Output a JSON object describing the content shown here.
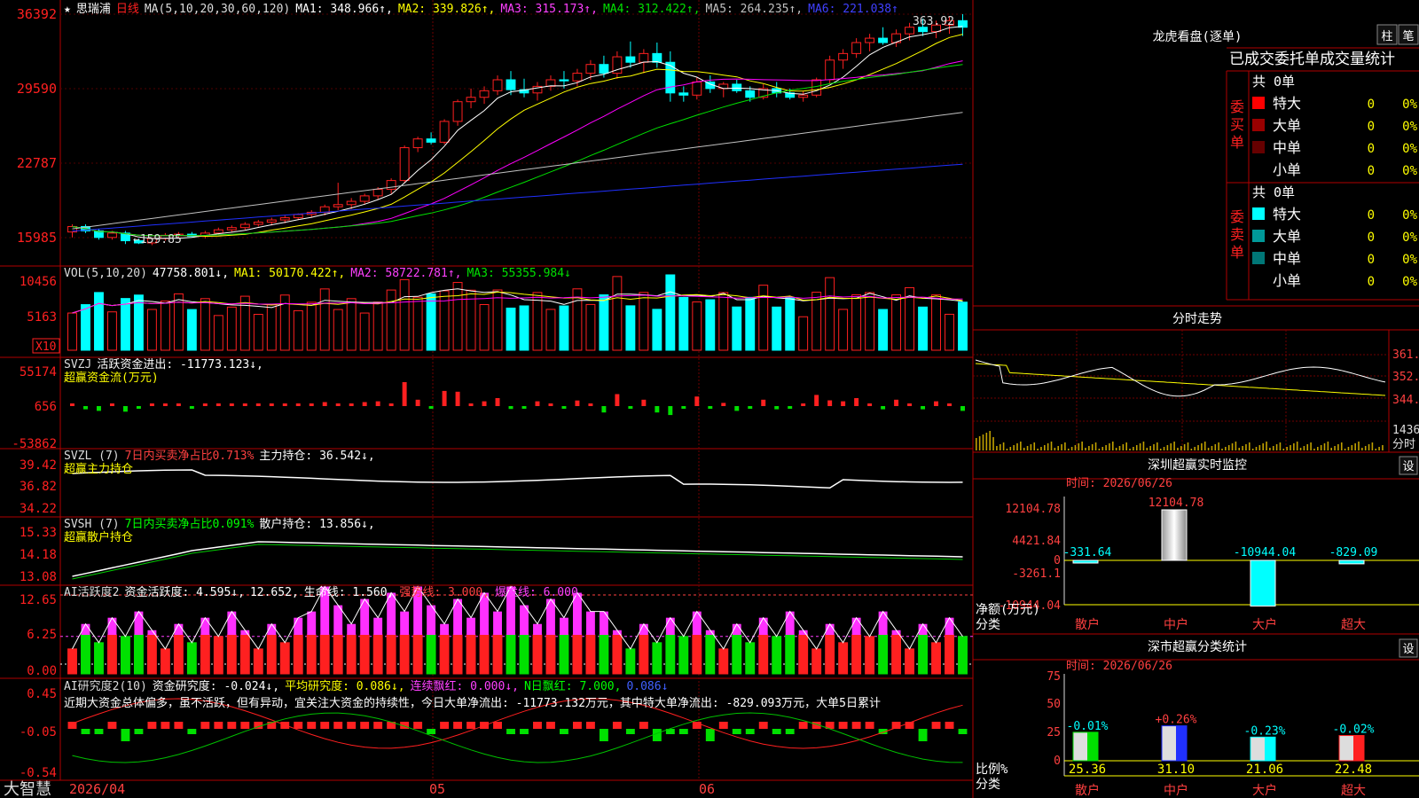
{
  "app": {
    "logo": "大智慧",
    "date_start": "2026/04",
    "month_may": "05",
    "month_jun": "06"
  },
  "colors": {
    "up": "#ff2020",
    "down": "#00ffff",
    "ma1": "#ffffff",
    "ma2": "#ffff00",
    "ma3": "#ff00ff",
    "ma4": "#00e000",
    "ma5": "#c0c0c0",
    "ma6": "#2030ff",
    "grid": "#b00000"
  },
  "kline": {
    "star": "★",
    "stock_name": "思瑞浦",
    "period": "日线",
    "ma_title": "MA(5,10,20,30,60,120)",
    "ma_items": [
      {
        "label": "MA1: 348.966↑,",
        "color": "#ffffff"
      },
      {
        "label": "MA2: 339.826↑,",
        "color": "#ffff00"
      },
      {
        "label": "MA3: 315.173↑,",
        "color": "#ff40ff"
      },
      {
        "label": "MA4: 312.422↑,",
        "color": "#00e000"
      },
      {
        "label": "MA5: 264.235↑,",
        "color": "#c0c0c0"
      },
      {
        "label": "MA6: 221.038↑",
        "color": "#4040ff"
      }
    ],
    "y_ticks": [
      "36392",
      "29590",
      "22787",
      "15985"
    ],
    "y_values": [
      363.92,
      295.9,
      227.87,
      159.85
    ],
    "high_label": "363.92",
    "low_label": "←159.85"
  },
  "chart_data": {
    "type": "candlestick",
    "ohlc": [
      [
        165,
        172,
        160,
        170
      ],
      [
        170,
        172,
        164,
        166
      ],
      [
        166,
        168,
        158,
        160
      ],
      [
        160,
        166,
        158,
        164
      ],
      [
        164,
        166,
        154,
        157
      ],
      [
        157,
        159,
        154,
        155
      ],
      [
        155,
        160,
        153,
        159
      ],
      [
        159,
        164,
        157,
        162
      ],
      [
        162,
        165,
        159,
        163
      ],
      [
        163,
        165,
        160,
        161
      ],
      [
        161,
        166,
        159,
        164
      ],
      [
        164,
        169,
        162,
        167
      ],
      [
        167,
        171,
        165,
        169
      ],
      [
        169,
        174,
        167,
        172
      ],
      [
        172,
        176,
        170,
        174
      ],
      [
        174,
        178,
        171,
        176
      ],
      [
        176,
        180,
        173,
        178
      ],
      [
        178,
        182,
        176,
        181
      ],
      [
        181,
        185,
        178,
        183
      ],
      [
        183,
        190,
        180,
        188
      ],
      [
        188,
        210,
        185,
        190
      ],
      [
        190,
        196,
        186,
        193
      ],
      [
        193,
        200,
        190,
        198
      ],
      [
        198,
        206,
        195,
        204
      ],
      [
        204,
        214,
        200,
        212
      ],
      [
        212,
        244,
        210,
        242
      ],
      [
        242,
        252,
        238,
        250
      ],
      [
        250,
        256,
        245,
        247
      ],
      [
        247,
        268,
        245,
        266
      ],
      [
        266,
        286,
        262,
        284
      ],
      [
        284,
        296,
        278,
        288
      ],
      [
        288,
        298,
        282,
        294
      ],
      [
        294,
        308,
        290,
        304
      ],
      [
        304,
        312,
        290,
        295
      ],
      [
        295,
        305,
        288,
        292
      ],
      [
        292,
        302,
        285,
        298
      ],
      [
        298,
        308,
        294,
        304
      ],
      [
        304,
        312,
        296,
        303
      ],
      [
        303,
        314,
        298,
        310
      ],
      [
        310,
        322,
        304,
        318
      ],
      [
        318,
        326,
        306,
        310
      ],
      [
        310,
        330,
        305,
        325
      ],
      [
        325,
        339,
        315,
        320
      ],
      [
        320,
        332,
        310,
        328
      ],
      [
        328,
        338,
        315,
        320
      ],
      [
        320,
        330,
        284,
        292
      ],
      [
        292,
        298,
        284,
        290
      ],
      [
        290,
        306,
        286,
        302
      ],
      [
        302,
        308,
        292,
        296
      ],
      [
        296,
        302,
        288,
        300
      ],
      [
        300,
        304,
        292,
        294
      ],
      [
        294,
        298,
        284,
        288
      ],
      [
        288,
        300,
        286,
        296
      ],
      [
        296,
        302,
        288,
        292
      ],
      [
        292,
        296,
        286,
        288
      ],
      [
        288,
        294,
        284,
        290
      ],
      [
        290,
        306,
        288,
        304
      ],
      [
        304,
        326,
        300,
        322
      ],
      [
        322,
        332,
        314,
        328
      ],
      [
        328,
        342,
        324,
        338
      ],
      [
        338,
        346,
        330,
        342
      ],
      [
        342,
        352,
        336,
        338
      ],
      [
        338,
        350,
        334,
        346
      ],
      [
        346,
        356,
        340,
        352
      ],
      [
        352,
        360,
        344,
        348
      ],
      [
        348,
        358,
        342,
        354
      ],
      [
        354,
        362,
        346,
        358
      ],
      [
        358,
        364,
        344,
        352
      ]
    ],
    "volume_ticks": [
      "10456",
      "5163"
    ],
    "volume_unit": "X10"
  },
  "vol": {
    "title": "VOL(5,10,20)",
    "items": [
      {
        "label": "47758.801↓,",
        "color": "#ffffff"
      },
      {
        "label": "MA1: 50170.422↑,",
        "color": "#ffff00"
      },
      {
        "label": "MA2: 58722.781↑,",
        "color": "#ff40ff"
      },
      {
        "label": "MA3: 55355.984↓",
        "color": "#00e000"
      }
    ]
  },
  "svzj": {
    "title": "SVZJ",
    "label": "活跃资金进出: -11773.123↓,",
    "sub": "超赢资金流(万元)",
    "ticks": [
      "55174",
      "656",
      "-53862"
    ]
  },
  "svzl": {
    "title": "SVZL (7)",
    "ratio": "7日内买卖净占比0.713%",
    "hold": "主力持仓: 36.542↓,",
    "sub": "超赢主力持仓",
    "ticks": [
      "39.42",
      "36.82",
      "34.22"
    ]
  },
  "svsh": {
    "title": "SVSH (7)",
    "ratio": "7日内买卖净占比0.091%",
    "hold": "散户持仓: 13.856↓,",
    "sub": "超赢散户持仓",
    "ticks": [
      "15.33",
      "14.18",
      "13.08"
    ]
  },
  "ai1": {
    "title": "AI活跃度2",
    "label": "资金活跃度: 4.595↓,",
    "v2": "12.652,",
    "life": "生命线: 1.560,",
    "strong": "强势线: 3.000,",
    "burst": "爆发线: 6.000,",
    "ticks": [
      "12.65",
      "6.25",
      "0.00"
    ]
  },
  "ai2": {
    "title": "AI研究度2(10)",
    "label": "资金研究度: -0.024↓,",
    "avg": "平均研究度: 0.086↓,",
    "red": "连续飘红: 0.000↓,",
    "nred": "N日飘红: 7.000,",
    "last": "0.086↓",
    "ticks": [
      "0.45",
      "-0.05",
      "-0.54"
    ],
    "comment": "近期大资金总体偏多，虽不活跃，但有异动，宜关注大资金的持续性，今日大单净流出: -11773.132万元，其中特大单净流出: -829.093万元，大单5日累计"
  },
  "dragon": {
    "title": "龙虎看盘(逐单)",
    "btn1": "柱",
    "btn2": "笔",
    "header": "已成交委托单成交量统计",
    "buy_label": "委买单",
    "sell_label": "委卖单",
    "buy_total": "共 0单",
    "sell_total": "共 0单",
    "buy_rows": [
      {
        "name": "特大",
        "count": "0",
        "pct": "0%",
        "color": "#ff0000"
      },
      {
        "name": "大单",
        "count": "0",
        "pct": "0%",
        "color": "#990000"
      },
      {
        "name": "中单",
        "count": "0",
        "pct": "0%",
        "color": "#660000"
      },
      {
        "name": "小单",
        "count": "0",
        "pct": "0%",
        "color": "#000000"
      }
    ],
    "sell_rows": [
      {
        "name": "特大",
        "count": "0",
        "pct": "0%",
        "color": "#00ffff"
      },
      {
        "name": "大单",
        "count": "0",
        "pct": "0%",
        "color": "#009999"
      },
      {
        "name": "中单",
        "count": "0",
        "pct": "0%",
        "color": "#007777"
      },
      {
        "name": "小单",
        "count": "0",
        "pct": "0%",
        "color": "#000000"
      }
    ]
  },
  "minute": {
    "title": "分时走势",
    "ticks": [
      "361.8",
      "352.9",
      "344.0"
    ],
    "vol": "1436",
    "unit": "分时"
  },
  "monitor": {
    "title": "深圳超赢实时监控",
    "set": "设",
    "time": "时间: 2026/06/26",
    "ticks": [
      "12104.78",
      "4421.84",
      "0",
      "-3261.1",
      "-10944.04"
    ],
    "ylabel": "净额(万元)",
    "xlabel": "分类",
    "bars": [
      {
        "name": "散户",
        "value": -331.64,
        "label": "-331.64"
      },
      {
        "name": "中户",
        "value": 12104.78,
        "label": "12104.78"
      },
      {
        "name": "大户",
        "value": -10944.04,
        "label": "-10944.04"
      },
      {
        "name": "超大",
        "value": -829.09,
        "label": "-829.09"
      }
    ]
  },
  "classify": {
    "title": "深市超赢分类统计",
    "set": "设",
    "time": "时间: 2026/06/26",
    "ticks": [
      "75",
      "50",
      "25",
      "0"
    ],
    "ylabel": "比例%",
    "xlabel": "分类",
    "bars": [
      {
        "name": "散户",
        "value": 25.36,
        "label": "25.36",
        "chg": "-0.01%"
      },
      {
        "name": "中户",
        "value": 31.1,
        "label": "31.10",
        "chg": "+0.26%"
      },
      {
        "name": "大户",
        "value": 21.06,
        "label": "21.06",
        "chg": "-0.23%"
      },
      {
        "name": "超大",
        "value": 22.48,
        "label": "22.48",
        "chg": "-0.02%"
      }
    ]
  }
}
